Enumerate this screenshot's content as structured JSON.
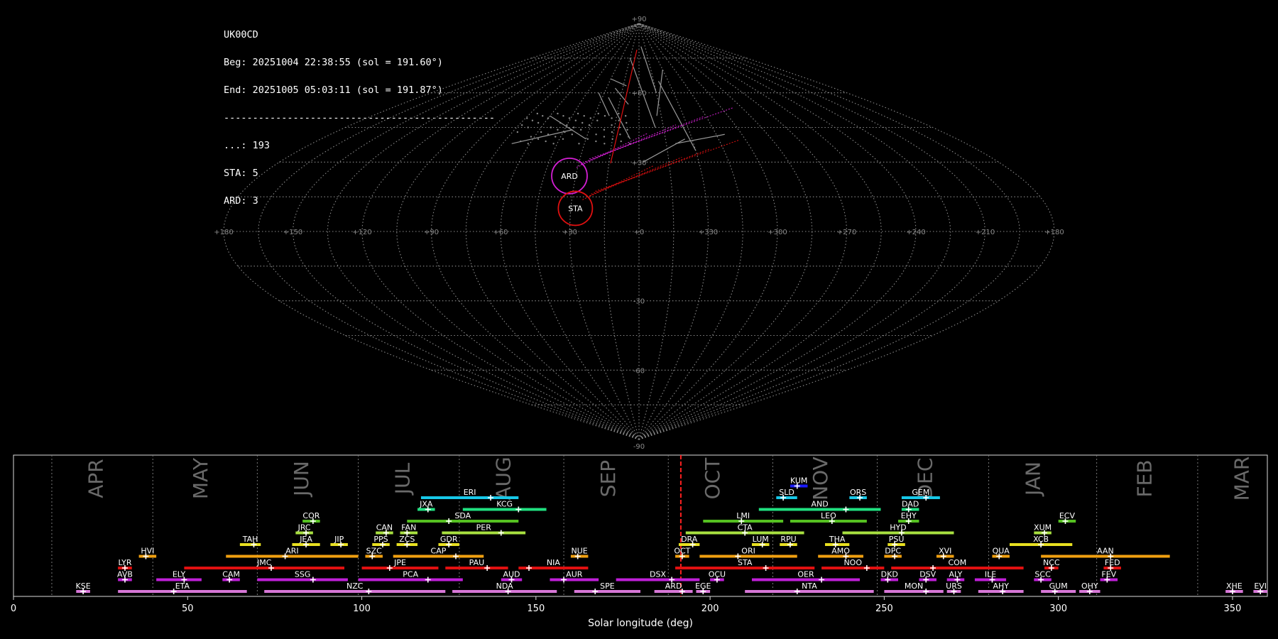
{
  "info": {
    "station": "UK00CD",
    "begin": "Beg: 20251004 22:38:55 (sol = 191.60°)",
    "end": "End: 20251005 05:03:11 (sol = 191.87°)",
    "separator": "-----------------------------------------------",
    "counts": [
      {
        "label": "...",
        "value": 193
      },
      {
        "label": "STA",
        "value": 5
      },
      {
        "label": "ARD",
        "value": 3
      }
    ]
  },
  "skymap": {
    "projection": "sinusoidal",
    "lon_labels": [
      "+180",
      "+150",
      "+120",
      "+90",
      "+60",
      "+30",
      "+0",
      "+330",
      "+300",
      "+270",
      "+240",
      "+210",
      "+180"
    ],
    "lat_labels": [
      "+90",
      "+60",
      "+30",
      "-30",
      "-60",
      "-90"
    ],
    "radiants": [
      {
        "name": "ARD",
        "color": "#d41fd4",
        "lon": 33,
        "lat": 24
      },
      {
        "name": "STA",
        "color": "#e01010",
        "lon": 28,
        "lat": 10
      }
    ]
  },
  "timeline": {
    "xlabel": "Solar longitude (deg)",
    "xlim": [
      0,
      360
    ],
    "x_ticks": [
      0,
      50,
      100,
      150,
      200,
      250,
      300,
      350
    ],
    "current_sol": 191.6,
    "months": [
      {
        "name": "APR",
        "start": 11,
        "center": 24
      },
      {
        "name": "MAY",
        "start": 40,
        "center": 54
      },
      {
        "name": "JUN",
        "start": 70,
        "center": 83
      },
      {
        "name": "JUL",
        "start": 99,
        "center": 112
      },
      {
        "name": "AUG",
        "start": 128,
        "center": 141
      },
      {
        "name": "SEP",
        "start": 158,
        "center": 171
      },
      {
        "name": "OCT",
        "start": 188,
        "center": 201
      },
      {
        "name": "NOV",
        "start": 218,
        "center": 232
      },
      {
        "name": "DEC",
        "start": 248,
        "center": 262
      },
      {
        "name": "JAN",
        "start": 280,
        "center": 293
      },
      {
        "name": "FEB",
        "start": 311,
        "center": 325
      },
      {
        "name": "MAR",
        "start": 340,
        "center": 353
      }
    ]
  },
  "chart_data": {
    "type": "timeline",
    "xlabel": "Solar longitude (deg)",
    "xlim": [
      0,
      360
    ],
    "rows": 10,
    "showers": [
      {
        "code": "KUM",
        "row": 9,
        "start": 223,
        "end": 228,
        "peak": 225,
        "color": "#1a1aff"
      },
      {
        "code": "ERI",
        "row": 8,
        "start": 117,
        "end": 145,
        "peak": 137,
        "color": "#17c8e8"
      },
      {
        "code": "SLD",
        "row": 8,
        "start": 219,
        "end": 225,
        "peak": 221,
        "color": "#17c8e8"
      },
      {
        "code": "ORS",
        "row": 8,
        "start": 240,
        "end": 245,
        "peak": 243,
        "color": "#17c8e8"
      },
      {
        "code": "GEM",
        "row": 8,
        "start": 255,
        "end": 266,
        "peak": 262,
        "color": "#17c8e8"
      },
      {
        "code": "JXA",
        "row": 7,
        "start": 116,
        "end": 121,
        "peak": 119,
        "color": "#20e080"
      },
      {
        "code": "KCG",
        "row": 7,
        "start": 129,
        "end": 153,
        "peak": 145,
        "color": "#20e080"
      },
      {
        "code": "AND",
        "row": 7,
        "start": 214,
        "end": 249,
        "peak": 239,
        "color": "#20e080"
      },
      {
        "code": "DAD",
        "row": 7,
        "start": 255,
        "end": 260,
        "peak": 257,
        "color": "#20e080"
      },
      {
        "code": "COR",
        "row": 6,
        "start": 83,
        "end": 88,
        "peak": 86,
        "color": "#55c021"
      },
      {
        "code": "SDA",
        "row": 6,
        "start": 113,
        "end": 145,
        "peak": 125,
        "color": "#55c021"
      },
      {
        "code": "LMI",
        "row": 6,
        "start": 198,
        "end": 221,
        "peak": 209,
        "color": "#55c021"
      },
      {
        "code": "LEO",
        "row": 6,
        "start": 223,
        "end": 245,
        "peak": 235,
        "color": "#55c021"
      },
      {
        "code": "EHY",
        "row": 6,
        "start": 254,
        "end": 260,
        "peak": 257,
        "color": "#55c021"
      },
      {
        "code": "ECV",
        "row": 6,
        "start": 300,
        "end": 305,
        "peak": 302,
        "color": "#55c021"
      },
      {
        "code": "JRC",
        "row": 5,
        "start": 81,
        "end": 86,
        "peak": 84,
        "color": "#a8e040"
      },
      {
        "code": "CAN",
        "row": 5,
        "start": 104,
        "end": 109,
        "peak": 107,
        "color": "#a8e040"
      },
      {
        "code": "FAN",
        "row": 5,
        "start": 111,
        "end": 116,
        "peak": 113,
        "color": "#a8e040"
      },
      {
        "code": "PER",
        "row": 5,
        "start": 123,
        "end": 147,
        "peak": 140,
        "color": "#a8e040"
      },
      {
        "code": "CTA",
        "row": 5,
        "start": 193,
        "end": 227,
        "peak": 210,
        "color": "#a8e040"
      },
      {
        "code": "HYD",
        "row": 5,
        "start": 238,
        "end": 270,
        "peak": 255,
        "color": "#a8e040"
      },
      {
        "code": "XUM",
        "row": 5,
        "start": 293,
        "end": 298,
        "peak": 296,
        "color": "#a8e040"
      },
      {
        "code": "TAH",
        "row": 4,
        "start": 65,
        "end": 71,
        "peak": 69,
        "color": "#e8e020"
      },
      {
        "code": "JEA",
        "row": 4,
        "start": 80,
        "end": 88,
        "peak": 84,
        "color": "#e8e020"
      },
      {
        "code": "JIP",
        "row": 4,
        "start": 91,
        "end": 96,
        "peak": 94,
        "color": "#e8e020"
      },
      {
        "code": "PPS",
        "row": 4,
        "start": 103,
        "end": 108,
        "peak": 106,
        "color": "#e8e020"
      },
      {
        "code": "ZCS",
        "row": 4,
        "start": 110,
        "end": 116,
        "peak": 113,
        "color": "#e8e020"
      },
      {
        "code": "GDR",
        "row": 4,
        "start": 122,
        "end": 128,
        "peak": 125,
        "color": "#e8e020"
      },
      {
        "code": "DRA",
        "row": 4,
        "start": 191,
        "end": 197,
        "peak": 195,
        "color": "#e8e020"
      },
      {
        "code": "LUM",
        "row": 4,
        "start": 212,
        "end": 217,
        "peak": 215,
        "color": "#e8e020"
      },
      {
        "code": "RPU",
        "row": 4,
        "start": 220,
        "end": 225,
        "peak": 223,
        "color": "#e8e020"
      },
      {
        "code": "THA",
        "row": 4,
        "start": 233,
        "end": 240,
        "peak": 236,
        "color": "#e8e020"
      },
      {
        "code": "PSU",
        "row": 4,
        "start": 251,
        "end": 256,
        "peak": 253,
        "color": "#e8e020"
      },
      {
        "code": "XCB",
        "row": 4,
        "start": 286,
        "end": 304,
        "peak": 295,
        "color": "#e8e020"
      },
      {
        "code": "HVI",
        "row": 3,
        "start": 36,
        "end": 41,
        "peak": 38,
        "color": "#f0a010"
      },
      {
        "code": "ARI",
        "row": 3,
        "start": 61,
        "end": 99,
        "peak": 78,
        "color": "#f0a010"
      },
      {
        "code": "SZC",
        "row": 3,
        "start": 101,
        "end": 106,
        "peak": 103,
        "color": "#f0a010"
      },
      {
        "code": "CAP",
        "row": 3,
        "start": 109,
        "end": 135,
        "peak": 127,
        "color": "#f0a010"
      },
      {
        "code": "NUE",
        "row": 3,
        "start": 160,
        "end": 165,
        "peak": 162,
        "color": "#f0a010"
      },
      {
        "code": "OCT",
        "row": 3,
        "start": 190,
        "end": 194,
        "peak": 192,
        "color": "#f0a010"
      },
      {
        "code": "ORI",
        "row": 3,
        "start": 197,
        "end": 225,
        "peak": 208,
        "color": "#f0a010"
      },
      {
        "code": "AMO",
        "row": 3,
        "start": 231,
        "end": 244,
        "peak": 239,
        "color": "#f0a010"
      },
      {
        "code": "DPC",
        "row": 3,
        "start": 250,
        "end": 255,
        "peak": 253,
        "color": "#f0a010"
      },
      {
        "code": "XVI",
        "row": 3,
        "start": 265,
        "end": 270,
        "peak": 267,
        "color": "#f0a010"
      },
      {
        "code": "QUA",
        "row": 3,
        "start": 281,
        "end": 286,
        "peak": 283,
        "color": "#f0a010"
      },
      {
        "code": "AAN",
        "row": 3,
        "start": 295,
        "end": 332,
        "peak": 315,
        "color": "#f0a010"
      },
      {
        "code": "LYR",
        "row": 2,
        "start": 30,
        "end": 34,
        "peak": 32,
        "color": "#e01010"
      },
      {
        "code": "JMC",
        "row": 2,
        "start": 49,
        "end": 95,
        "peak": 74,
        "color": "#e01010"
      },
      {
        "code": "JPE",
        "row": 2,
        "start": 100,
        "end": 122,
        "peak": 108,
        "color": "#e01010"
      },
      {
        "code": "PAU",
        "row": 2,
        "start": 124,
        "end": 142,
        "peak": 136,
        "color": "#e01010"
      },
      {
        "code": "NIA",
        "row": 2,
        "start": 145,
        "end": 165,
        "peak": 148,
        "color": "#e01010"
      },
      {
        "code": "STA",
        "row": 2,
        "start": 190,
        "end": 230,
        "peak": 216,
        "color": "#e01010"
      },
      {
        "code": "NOO",
        "row": 2,
        "start": 232,
        "end": 250,
        "peak": 245,
        "color": "#e01010"
      },
      {
        "code": "COM",
        "row": 2,
        "start": 252,
        "end": 290,
        "peak": 264,
        "color": "#e01010"
      },
      {
        "code": "NCC",
        "row": 2,
        "start": 296,
        "end": 300,
        "peak": 298,
        "color": "#e01010"
      },
      {
        "code": "FED",
        "row": 2,
        "start": 313,
        "end": 318,
        "peak": 315,
        "color": "#e01010"
      },
      {
        "code": "AVB",
        "row": 1,
        "start": 30,
        "end": 34,
        "peak": 32,
        "color": "#c020d8"
      },
      {
        "code": "ELY",
        "row": 1,
        "start": 41,
        "end": 54,
        "peak": 49,
        "color": "#c020d8"
      },
      {
        "code": "CAM",
        "row": 1,
        "start": 60,
        "end": 65,
        "peak": 62,
        "color": "#c020d8"
      },
      {
        "code": "SSG",
        "row": 1,
        "start": 70,
        "end": 96,
        "peak": 86,
        "color": "#c020d8"
      },
      {
        "code": "PCA",
        "row": 1,
        "start": 99,
        "end": 129,
        "peak": 119,
        "color": "#c020d8"
      },
      {
        "code": "AUD",
        "row": 1,
        "start": 140,
        "end": 146,
        "peak": 143,
        "color": "#c020d8"
      },
      {
        "code": "AUR",
        "row": 1,
        "start": 154,
        "end": 168,
        "peak": 158,
        "color": "#c020d8"
      },
      {
        "code": "DSX",
        "row": 1,
        "start": 173,
        "end": 197,
        "peak": 189,
        "color": "#c020d8"
      },
      {
        "code": "OCU",
        "row": 1,
        "start": 200,
        "end": 204,
        "peak": 202,
        "color": "#c020d8"
      },
      {
        "code": "OER",
        "row": 1,
        "start": 212,
        "end": 243,
        "peak": 232,
        "color": "#c020d8"
      },
      {
        "code": "DKD",
        "row": 1,
        "start": 249,
        "end": 254,
        "peak": 251,
        "color": "#c020d8"
      },
      {
        "code": "DSV",
        "row": 1,
        "start": 260,
        "end": 265,
        "peak": 262,
        "color": "#c020d8"
      },
      {
        "code": "ALY",
        "row": 1,
        "start": 268,
        "end": 273,
        "peak": 271,
        "color": "#c020d8"
      },
      {
        "code": "ILE",
        "row": 1,
        "start": 276,
        "end": 285,
        "peak": 281,
        "color": "#c020d8"
      },
      {
        "code": "SCC",
        "row": 1,
        "start": 293,
        "end": 298,
        "peak": 295,
        "color": "#c020d8"
      },
      {
        "code": "FEV",
        "row": 1,
        "start": 312,
        "end": 317,
        "peak": 314,
        "color": "#c020d8"
      },
      {
        "code": "KSE",
        "row": 0,
        "start": 18,
        "end": 22,
        "peak": 20,
        "color": "#d878d8"
      },
      {
        "code": "ETA",
        "row": 0,
        "start": 30,
        "end": 67,
        "peak": 46,
        "color": "#d878d8"
      },
      {
        "code": "NZC",
        "row": 0,
        "start": 72,
        "end": 124,
        "peak": 102,
        "color": "#d878d8"
      },
      {
        "code": "NDA",
        "row": 0,
        "start": 126,
        "end": 156,
        "peak": 142,
        "color": "#d878d8"
      },
      {
        "code": "SPE",
        "row": 0,
        "start": 161,
        "end": 180,
        "peak": 167,
        "color": "#d878d8"
      },
      {
        "code": "ARD",
        "row": 0,
        "start": 184,
        "end": 195,
        "peak": 192,
        "color": "#d878d8"
      },
      {
        "code": "EGE",
        "row": 0,
        "start": 196,
        "end": 200,
        "peak": 198,
        "color": "#d878d8"
      },
      {
        "code": "NTA",
        "row": 0,
        "start": 210,
        "end": 247,
        "peak": 225,
        "color": "#d878d8"
      },
      {
        "code": "MON",
        "row": 0,
        "start": 250,
        "end": 267,
        "peak": 262,
        "color": "#d878d8"
      },
      {
        "code": "URS",
        "row": 0,
        "start": 268,
        "end": 272,
        "peak": 270,
        "color": "#d878d8"
      },
      {
        "code": "AHY",
        "row": 0,
        "start": 277,
        "end": 290,
        "peak": 284,
        "color": "#d878d8"
      },
      {
        "code": "GUM",
        "row": 0,
        "start": 295,
        "end": 305,
        "peak": 299,
        "color": "#d878d8"
      },
      {
        "code": "OHY",
        "row": 0,
        "start": 306,
        "end": 312,
        "peak": 309,
        "color": "#d878d8"
      },
      {
        "code": "XHE",
        "row": 0,
        "start": 348,
        "end": 353,
        "peak": 350,
        "color": "#d878d8"
      },
      {
        "code": "EVI",
        "row": 0,
        "start": 356,
        "end": 360,
        "peak": 358,
        "color": "#d878d8"
      }
    ]
  }
}
